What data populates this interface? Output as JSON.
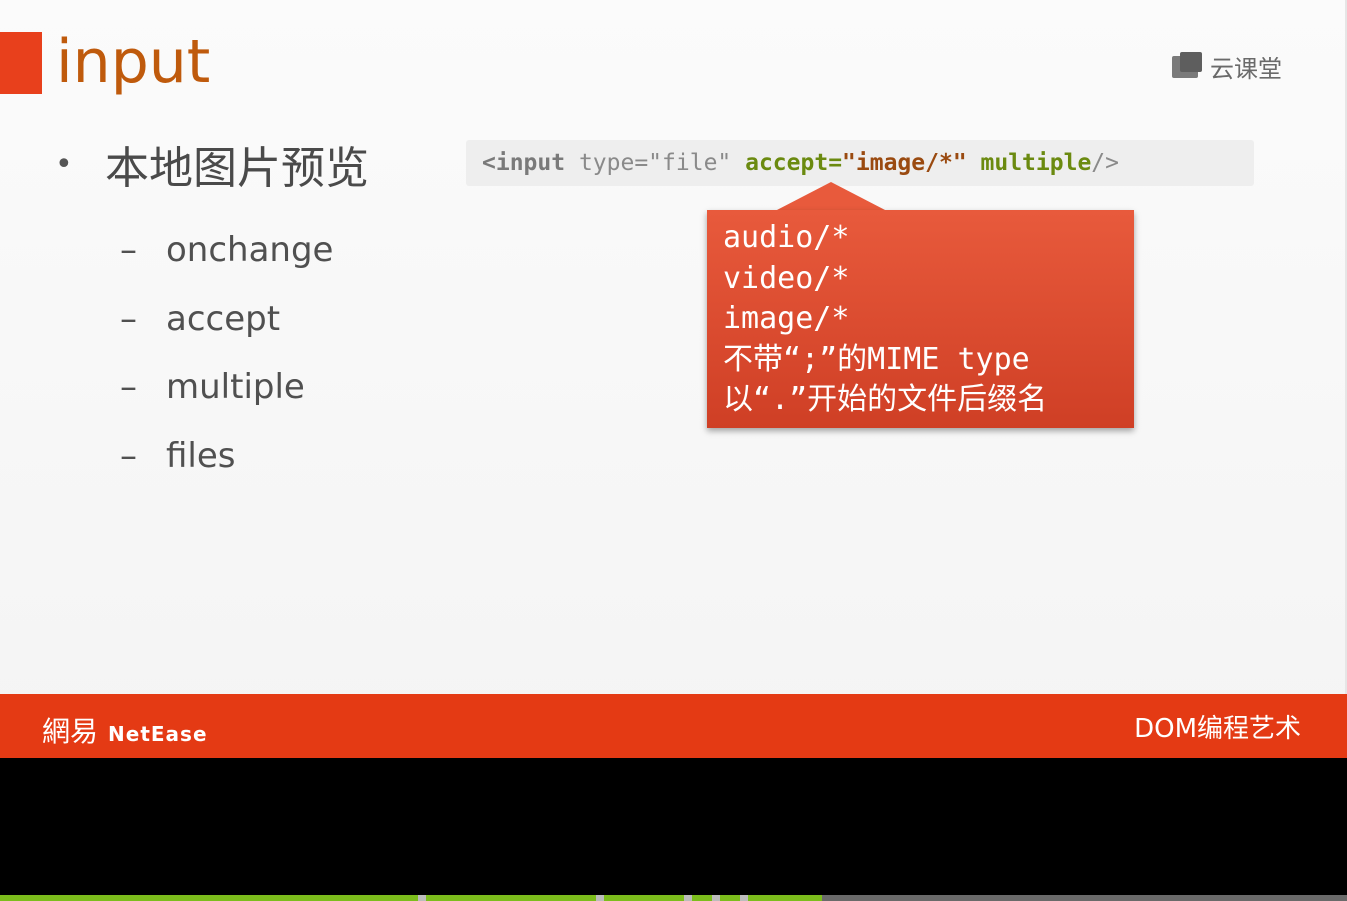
{
  "slide": {
    "title": "input",
    "logo_text": "云课堂",
    "main_bullet": "本地图片预览",
    "sub_items": [
      "onchange",
      "accept",
      "multiple",
      "files"
    ],
    "code": {
      "lt_input": "<input",
      "type_attr": " type=\"file\" ",
      "accept_attr": "accept=",
      "accept_value": "\"image/*\"",
      "multiple_attr": " multiple",
      "close": "/>"
    },
    "callout_lines": [
      "audio/*",
      "video/*",
      "image/*",
      "不带“;”的MIME type",
      "以“.”开始的文件后缀名"
    ]
  },
  "footer": {
    "brand_cn": "網易",
    "brand_en": "NetEase",
    "course": "DOM编程艺术"
  },
  "player": {
    "progress_fraction": 0.61
  },
  "colors": {
    "accent": "#e8401c",
    "title": "#bf5a0c",
    "callout": "#e85a3c",
    "footer": "#e43a14",
    "progress": "#7cbd1c"
  },
  "icons": {
    "logo": "cloud-classroom-logo-icon"
  }
}
